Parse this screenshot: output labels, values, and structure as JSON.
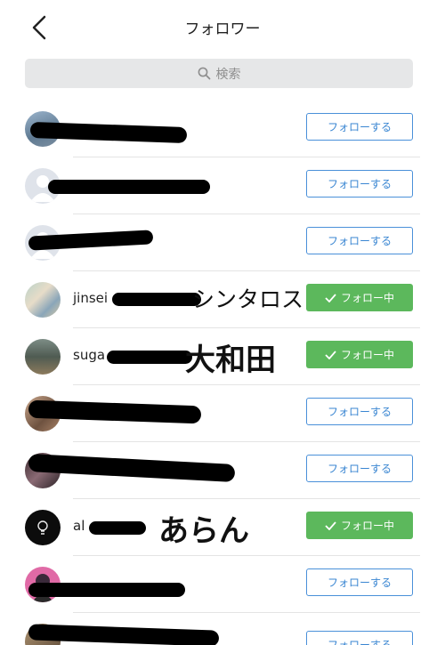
{
  "header": {
    "title": "フォロワー",
    "back_icon": "chevron-left-icon"
  },
  "search": {
    "placeholder": "検索",
    "icon": "search-icon"
  },
  "colors": {
    "follow_border": "#4a90d9",
    "following_bg": "#5cb85c"
  },
  "followers": [
    {
      "username": "",
      "annotation": "",
      "button": "フォローする",
      "state": "follow"
    },
    {
      "username": "",
      "annotation": "",
      "button": "フォローする",
      "state": "follow"
    },
    {
      "username": "",
      "annotation": "",
      "button": "フォローする",
      "state": "follow"
    },
    {
      "username": "jinsei",
      "annotation": "シンタロス",
      "button": "フォロー中",
      "state": "following"
    },
    {
      "username": "suga",
      "annotation": "大和田",
      "button": "フォロー中",
      "state": "following"
    },
    {
      "username": "",
      "annotation": "",
      "button": "フォローする",
      "state": "follow"
    },
    {
      "username": "",
      "annotation": "",
      "button": "フォローする",
      "state": "follow"
    },
    {
      "username": "al",
      "annotation": "あらん",
      "button": "フォロー中",
      "state": "following"
    },
    {
      "username": "",
      "annotation": "",
      "button": "フォローする",
      "state": "follow"
    },
    {
      "username": "",
      "annotation": "",
      "button": "フォローする",
      "state": "follow"
    }
  ]
}
